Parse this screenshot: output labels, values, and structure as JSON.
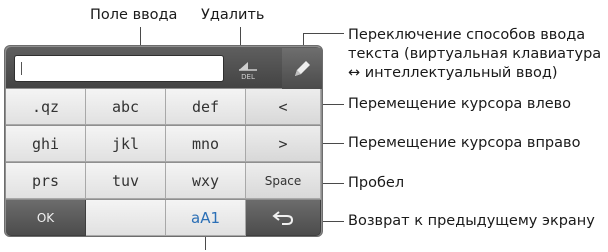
{
  "labels": {
    "input_field": "Поле ввода",
    "delete": "Удалить",
    "mode_switch_line1": "Переключение способов ввода",
    "mode_switch_line2": "текста (виртуальная клавиатура",
    "mode_switch_line3": "↔ интеллектуальный ввод)",
    "cursor_left": "Перемещение курсора влево",
    "cursor_right": "Перемещение курсора вправо",
    "space": "Пробел",
    "back": "Возврат к предыдущему экрану"
  },
  "keyboard": {
    "del_label": "DEL",
    "rows": [
      [
        ".qz",
        "abc",
        "def",
        "<"
      ],
      [
        "ghi",
        "jkl",
        "mno",
        ">"
      ],
      [
        "prs",
        "tuv",
        "wxy",
        "Space"
      ],
      [
        "OK",
        "",
        "aA1",
        "↩"
      ]
    ]
  },
  "colors": {
    "mode_key_accent": "#2b6fb6",
    "topbar": "#4a4a4a",
    "key_light": "#ececec",
    "key_dark": "#555555"
  },
  "icons": {
    "delete": "backspace-del-icon",
    "mode": "pencil-icon",
    "back": "return-arrow-icon"
  }
}
